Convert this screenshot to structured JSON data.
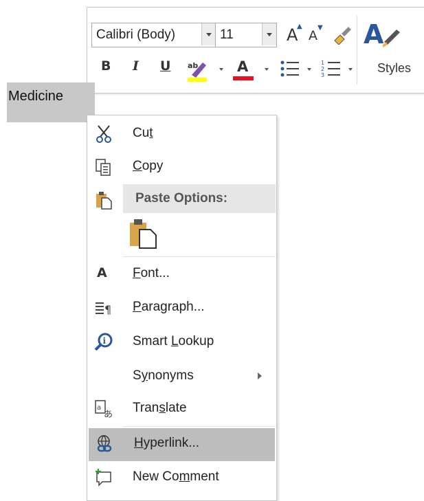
{
  "toolbar": {
    "font_name": "Calibri (Body)",
    "font_size": "11",
    "grow_font_icon": "A",
    "shrink_font_icon": "A",
    "bold": "B",
    "italic": "I",
    "underline": "U",
    "font_color_icon": "A",
    "styles_label": "Styles",
    "highlight_color": "#ffff00",
    "font_color": "#e81123",
    "accent_color": "#2b579a"
  },
  "document": {
    "selected_word": "Medicine"
  },
  "context_menu": {
    "cut": {
      "pre": "Cu",
      "u": "t",
      "post": ""
    },
    "copy": {
      "pre": "",
      "u": "C",
      "post": "opy"
    },
    "paste_options": "Paste Options:",
    "font": {
      "pre": "",
      "u": "F",
      "post": "ont..."
    },
    "font_icon": "A",
    "paragraph": {
      "pre": "",
      "u": "P",
      "post": "aragraph..."
    },
    "smart_lookup": {
      "pre": "Smart ",
      "u": "L",
      "post": "ookup"
    },
    "synonyms": {
      "pre": "S",
      "u": "y",
      "post": "nonyms"
    },
    "translate": {
      "pre": "Tran",
      "u": "s",
      "post": "late"
    },
    "hyperlink": {
      "pre": "",
      "u": "H",
      "post": "yperlink..."
    },
    "new_comment": {
      "pre": "New Co",
      "u": "m",
      "post": "ment"
    }
  }
}
